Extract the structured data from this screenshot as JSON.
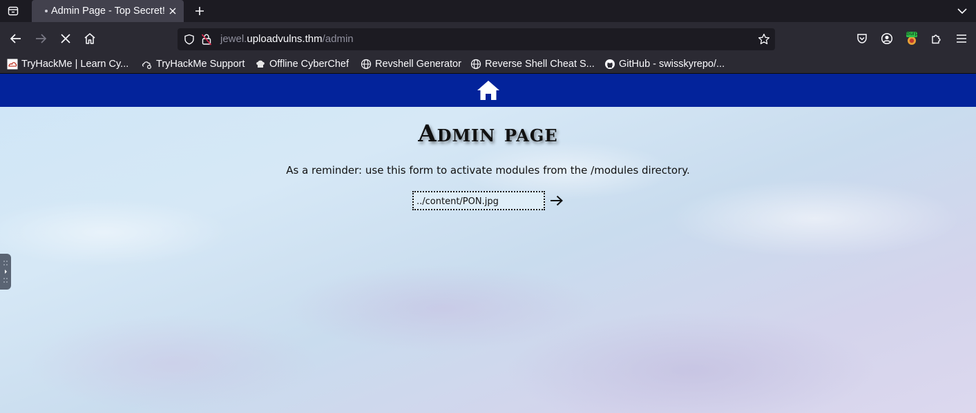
{
  "browser": {
    "tab": {
      "title": "Admin Page - Top Secret!"
    },
    "url": {
      "prefix": "jewel.",
      "host": "uploadvulns.thm",
      "path": "/admin"
    },
    "bookmarks": [
      {
        "label": "TryHackMe | Learn Cy...",
        "icon": "tryhackme-favicon"
      },
      {
        "label": "TryHackMe Support",
        "icon": "cloud-gear-icon"
      },
      {
        "label": "Offline CyberChef",
        "icon": "chef-hat-icon"
      },
      {
        "label": "Revshell Generator",
        "icon": "globe-icon"
      },
      {
        "label": "Reverse Shell Cheat S...",
        "icon": "globe-icon"
      },
      {
        "label": "GitHub - swisskyrepo/...",
        "icon": "github-icon"
      }
    ],
    "burp_badge": "Burp"
  },
  "page": {
    "title": "Admin page",
    "reminder": "As a reminder: use this form to activate modules from the /modules directory.",
    "module_input": {
      "value": "../content/PON.jpg"
    }
  },
  "colors": {
    "header": "#03239b",
    "tab_active": "#42414d",
    "toolbar": "#2b2a33",
    "tabstrip": "#1c1b22"
  }
}
